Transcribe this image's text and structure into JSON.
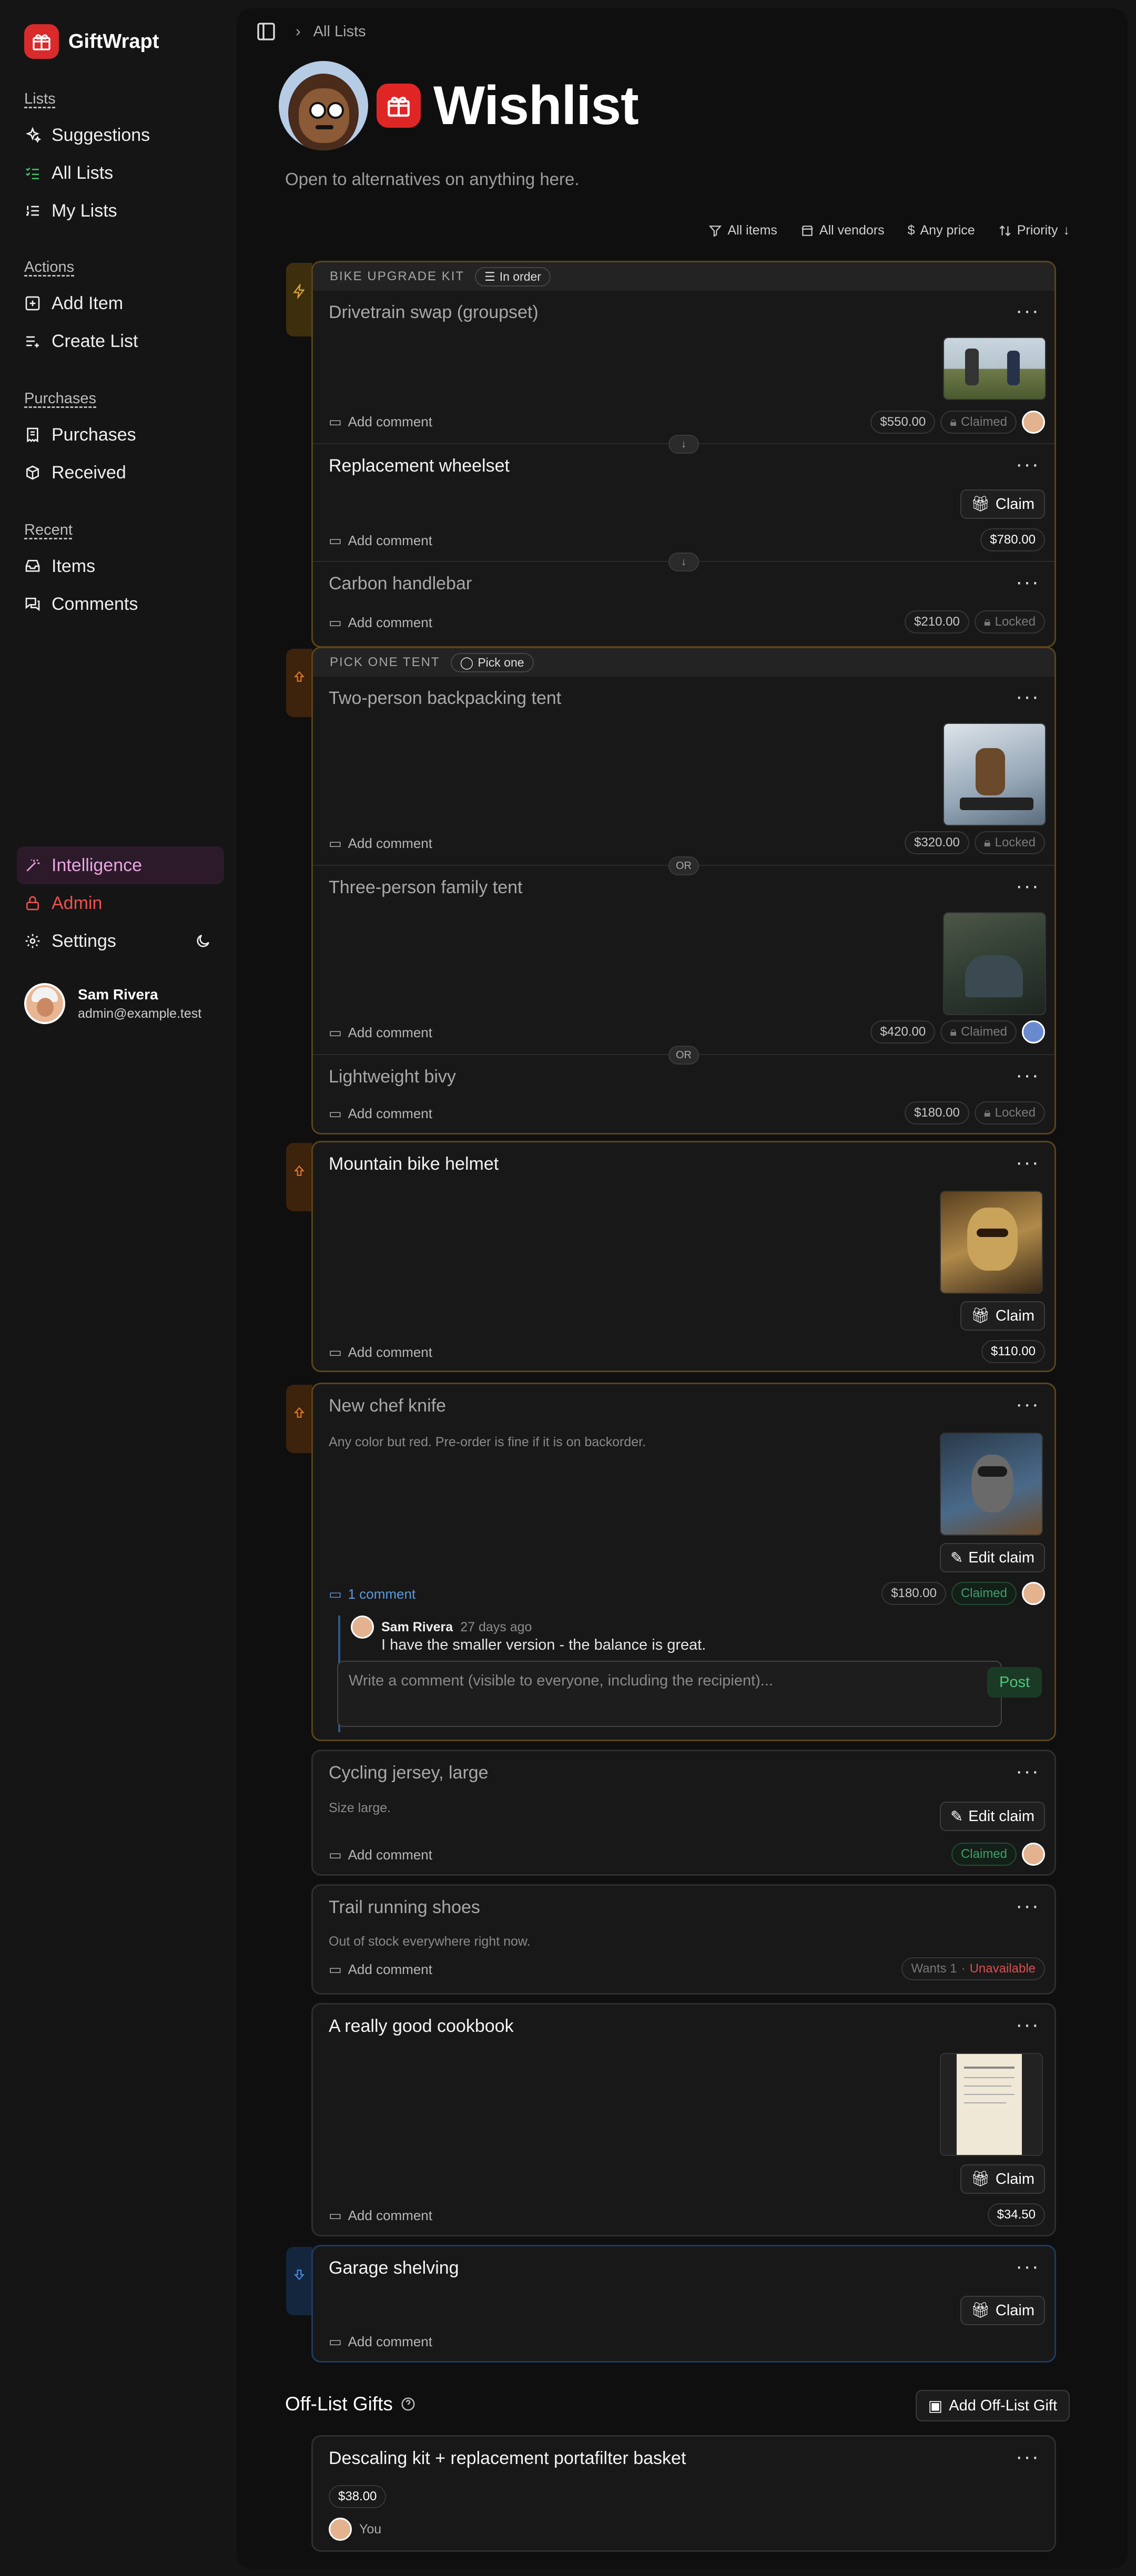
{
  "brand": {
    "name": "GiftWrapt"
  },
  "sidebar": {
    "lists_head": "Lists",
    "lists": [
      "Suggestions",
      "All Lists",
      "My Lists"
    ],
    "actions_head": "Actions",
    "actions": [
      "Add Item",
      "Create List"
    ],
    "purchases_head": "Purchases",
    "purchases": [
      "Purchases",
      "Received"
    ],
    "recent_head": "Recent",
    "recent": [
      "Items",
      "Comments"
    ],
    "bottom": [
      "Intelligence",
      "Admin",
      "Settings"
    ]
  },
  "user": {
    "name": "Sam Rivera",
    "email": "admin@example.test"
  },
  "breadcrumb": "All Lists",
  "page": {
    "title": "Wishlist",
    "subtitle": "Open to alternatives on anything here."
  },
  "filters": [
    "All items",
    "All vendors",
    "Any price",
    "Priority"
  ],
  "common": {
    "add_comment": "Add comment",
    "claim": "Claim",
    "edit_claim": "Edit claim",
    "claimed": "Claimed",
    "locked": "Locked",
    "or": "OR"
  },
  "bike_group": {
    "label": "BIKE UPGRADE KIT",
    "chip": "In order",
    "items": [
      {
        "name": "Drivetrain swap (groupset)",
        "price": "$550.00"
      },
      {
        "name": "Replacement wheelset",
        "price": "$780.00"
      },
      {
        "name": "Carbon handlebar",
        "price": "$210.00"
      }
    ]
  },
  "tent_group": {
    "label": "PICK ONE TENT",
    "chip": "Pick one",
    "items": [
      {
        "name": "Two-person backpacking tent",
        "price": "$320.00"
      },
      {
        "name": "Three-person family tent",
        "price": "$420.00"
      },
      {
        "name": "Lightweight bivy",
        "price": "$180.00"
      }
    ]
  },
  "helmet": {
    "name": "Mountain bike helmet",
    "price": "$110.00"
  },
  "knife": {
    "name": "New chef knife",
    "note": "Any color but red. Pre-order is fine if it is on backorder.",
    "comments_count": "1 comment",
    "price": "$180.00",
    "comment_author": "Sam Rivera",
    "comment_time": "27 days ago",
    "comment_text": "I have the smaller version - the balance is great.",
    "input_placeholder": "Write a comment (visible to everyone, including the recipient)...",
    "post": "Post"
  },
  "jersey": {
    "name": "Cycling jersey, large",
    "note": "Size large."
  },
  "shoes": {
    "name": "Trail running shoes",
    "note": "Out of stock everywhere right now.",
    "wants": "Wants 1",
    "unavailable": "Unavailable"
  },
  "cookbook": {
    "name": "A really good cookbook",
    "price": "$34.50"
  },
  "shelving": {
    "name": "Garage shelving"
  },
  "offlist": {
    "title": "Off-List Gifts",
    "add_button": "Add Off-List Gift",
    "item": {
      "name": "Descaling kit + replacement portafilter basket",
      "price": "$38.00",
      "by": "You"
    }
  },
  "colors": {
    "brand": "#d92b2b",
    "accent_orange": "#5a4418",
    "claimed_green": "#3f9d6a",
    "link_blue": "#5a9bdc",
    "intelligence_pink": "#e7a6e0",
    "admin_red": "#ef5050"
  }
}
